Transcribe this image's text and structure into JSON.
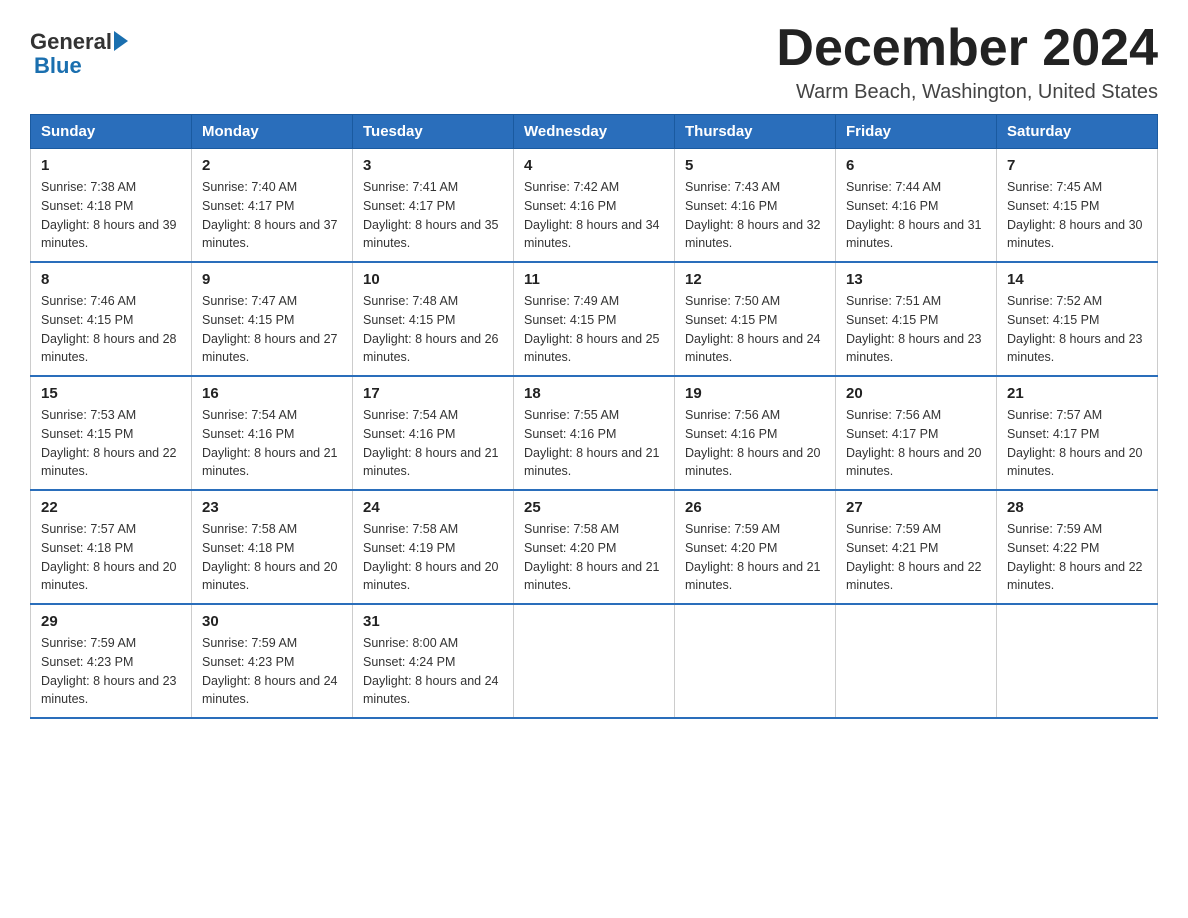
{
  "header": {
    "logo_text_general": "General",
    "logo_text_blue": "Blue",
    "month_title": "December 2024",
    "location": "Warm Beach, Washington, United States"
  },
  "days_of_week": [
    "Sunday",
    "Monday",
    "Tuesday",
    "Wednesday",
    "Thursday",
    "Friday",
    "Saturday"
  ],
  "weeks": [
    [
      {
        "day": "1",
        "sunrise": "7:38 AM",
        "sunset": "4:18 PM",
        "daylight": "8 hours and 39 minutes."
      },
      {
        "day": "2",
        "sunrise": "7:40 AM",
        "sunset": "4:17 PM",
        "daylight": "8 hours and 37 minutes."
      },
      {
        "day": "3",
        "sunrise": "7:41 AM",
        "sunset": "4:17 PM",
        "daylight": "8 hours and 35 minutes."
      },
      {
        "day": "4",
        "sunrise": "7:42 AM",
        "sunset": "4:16 PM",
        "daylight": "8 hours and 34 minutes."
      },
      {
        "day": "5",
        "sunrise": "7:43 AM",
        "sunset": "4:16 PM",
        "daylight": "8 hours and 32 minutes."
      },
      {
        "day": "6",
        "sunrise": "7:44 AM",
        "sunset": "4:16 PM",
        "daylight": "8 hours and 31 minutes."
      },
      {
        "day": "7",
        "sunrise": "7:45 AM",
        "sunset": "4:15 PM",
        "daylight": "8 hours and 30 minutes."
      }
    ],
    [
      {
        "day": "8",
        "sunrise": "7:46 AM",
        "sunset": "4:15 PM",
        "daylight": "8 hours and 28 minutes."
      },
      {
        "day": "9",
        "sunrise": "7:47 AM",
        "sunset": "4:15 PM",
        "daylight": "8 hours and 27 minutes."
      },
      {
        "day": "10",
        "sunrise": "7:48 AM",
        "sunset": "4:15 PM",
        "daylight": "8 hours and 26 minutes."
      },
      {
        "day": "11",
        "sunrise": "7:49 AM",
        "sunset": "4:15 PM",
        "daylight": "8 hours and 25 minutes."
      },
      {
        "day": "12",
        "sunrise": "7:50 AM",
        "sunset": "4:15 PM",
        "daylight": "8 hours and 24 minutes."
      },
      {
        "day": "13",
        "sunrise": "7:51 AM",
        "sunset": "4:15 PM",
        "daylight": "8 hours and 23 minutes."
      },
      {
        "day": "14",
        "sunrise": "7:52 AM",
        "sunset": "4:15 PM",
        "daylight": "8 hours and 23 minutes."
      }
    ],
    [
      {
        "day": "15",
        "sunrise": "7:53 AM",
        "sunset": "4:15 PM",
        "daylight": "8 hours and 22 minutes."
      },
      {
        "day": "16",
        "sunrise": "7:54 AM",
        "sunset": "4:16 PM",
        "daylight": "8 hours and 21 minutes."
      },
      {
        "day": "17",
        "sunrise": "7:54 AM",
        "sunset": "4:16 PM",
        "daylight": "8 hours and 21 minutes."
      },
      {
        "day": "18",
        "sunrise": "7:55 AM",
        "sunset": "4:16 PM",
        "daylight": "8 hours and 21 minutes."
      },
      {
        "day": "19",
        "sunrise": "7:56 AM",
        "sunset": "4:16 PM",
        "daylight": "8 hours and 20 minutes."
      },
      {
        "day": "20",
        "sunrise": "7:56 AM",
        "sunset": "4:17 PM",
        "daylight": "8 hours and 20 minutes."
      },
      {
        "day": "21",
        "sunrise": "7:57 AM",
        "sunset": "4:17 PM",
        "daylight": "8 hours and 20 minutes."
      }
    ],
    [
      {
        "day": "22",
        "sunrise": "7:57 AM",
        "sunset": "4:18 PM",
        "daylight": "8 hours and 20 minutes."
      },
      {
        "day": "23",
        "sunrise": "7:58 AM",
        "sunset": "4:18 PM",
        "daylight": "8 hours and 20 minutes."
      },
      {
        "day": "24",
        "sunrise": "7:58 AM",
        "sunset": "4:19 PM",
        "daylight": "8 hours and 20 minutes."
      },
      {
        "day": "25",
        "sunrise": "7:58 AM",
        "sunset": "4:20 PM",
        "daylight": "8 hours and 21 minutes."
      },
      {
        "day": "26",
        "sunrise": "7:59 AM",
        "sunset": "4:20 PM",
        "daylight": "8 hours and 21 minutes."
      },
      {
        "day": "27",
        "sunrise": "7:59 AM",
        "sunset": "4:21 PM",
        "daylight": "8 hours and 22 minutes."
      },
      {
        "day": "28",
        "sunrise": "7:59 AM",
        "sunset": "4:22 PM",
        "daylight": "8 hours and 22 minutes."
      }
    ],
    [
      {
        "day": "29",
        "sunrise": "7:59 AM",
        "sunset": "4:23 PM",
        "daylight": "8 hours and 23 minutes."
      },
      {
        "day": "30",
        "sunrise": "7:59 AM",
        "sunset": "4:23 PM",
        "daylight": "8 hours and 24 minutes."
      },
      {
        "day": "31",
        "sunrise": "8:00 AM",
        "sunset": "4:24 PM",
        "daylight": "8 hours and 24 minutes."
      },
      null,
      null,
      null,
      null
    ]
  ]
}
